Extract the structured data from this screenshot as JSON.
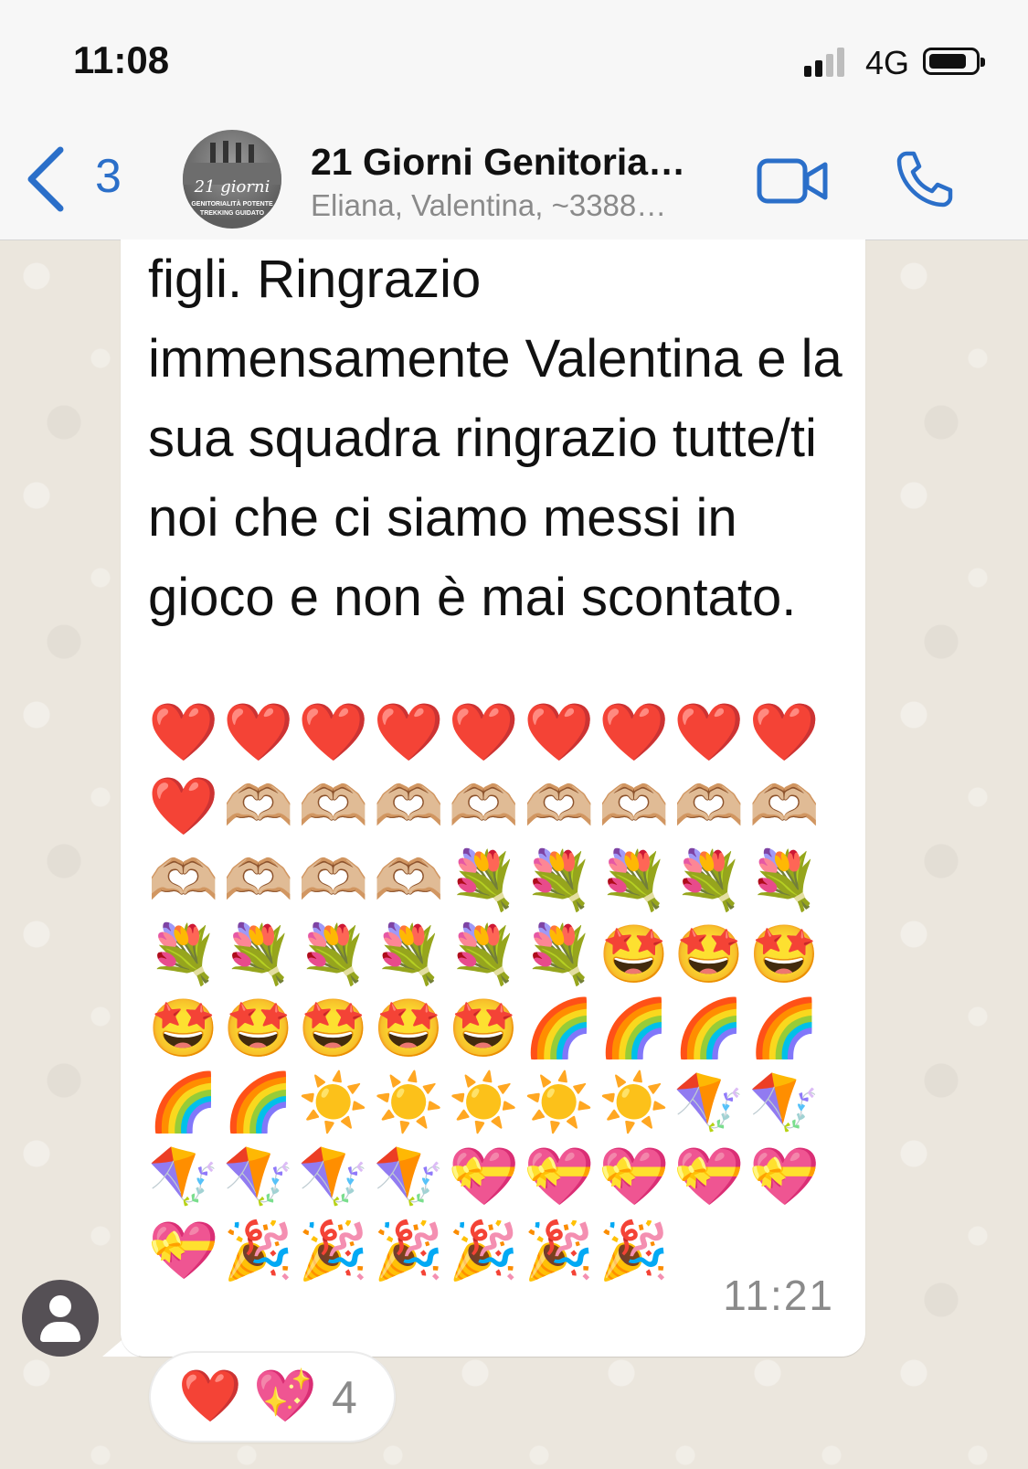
{
  "status_bar": {
    "time": "11:08",
    "network": "4G"
  },
  "header": {
    "back_count": "3",
    "group_name": "21 Giorni Genitoria…",
    "members": "Eliana, Valentina, ~3388…",
    "avatar_logo": "21 giorni",
    "avatar_tagline_1": "GENITORIALITÀ POTENTE",
    "avatar_tagline_2": "TREKKING GUIDATO",
    "icons": [
      "chevron-left-icon",
      "video-camera-icon",
      "phone-icon"
    ],
    "accent_color": "#2b6fc9"
  },
  "message": {
    "text": "figli. Ringrazio immensamente Valentina e la sua squadra ringrazio tutte/ti noi che ci siamo messi in gioco e non è mai scontato.",
    "emojis": "❤️❤️❤️❤️❤️❤️❤️❤️❤️❤️🫶🏼🫶🏼🫶🏼🫶🏼🫶🏼🫶🏼🫶🏼🫶🏼🫶🏼🫶🏼🫶🏼🫶🏼💐💐💐💐💐💐💐💐💐💐💐🤩🤩🤩🤩🤩🤩🤩🤩🌈🌈🌈🌈🌈🌈☀️☀️☀️☀️☀️🪁🪁🪁🪁🪁🪁💝💝💝💝💝💝🎉🎉🎉🎉🎉🎉",
    "time": "11:21"
  },
  "reactions": {
    "emoji_1": "❤️",
    "emoji_2": "💖",
    "count": "4"
  }
}
